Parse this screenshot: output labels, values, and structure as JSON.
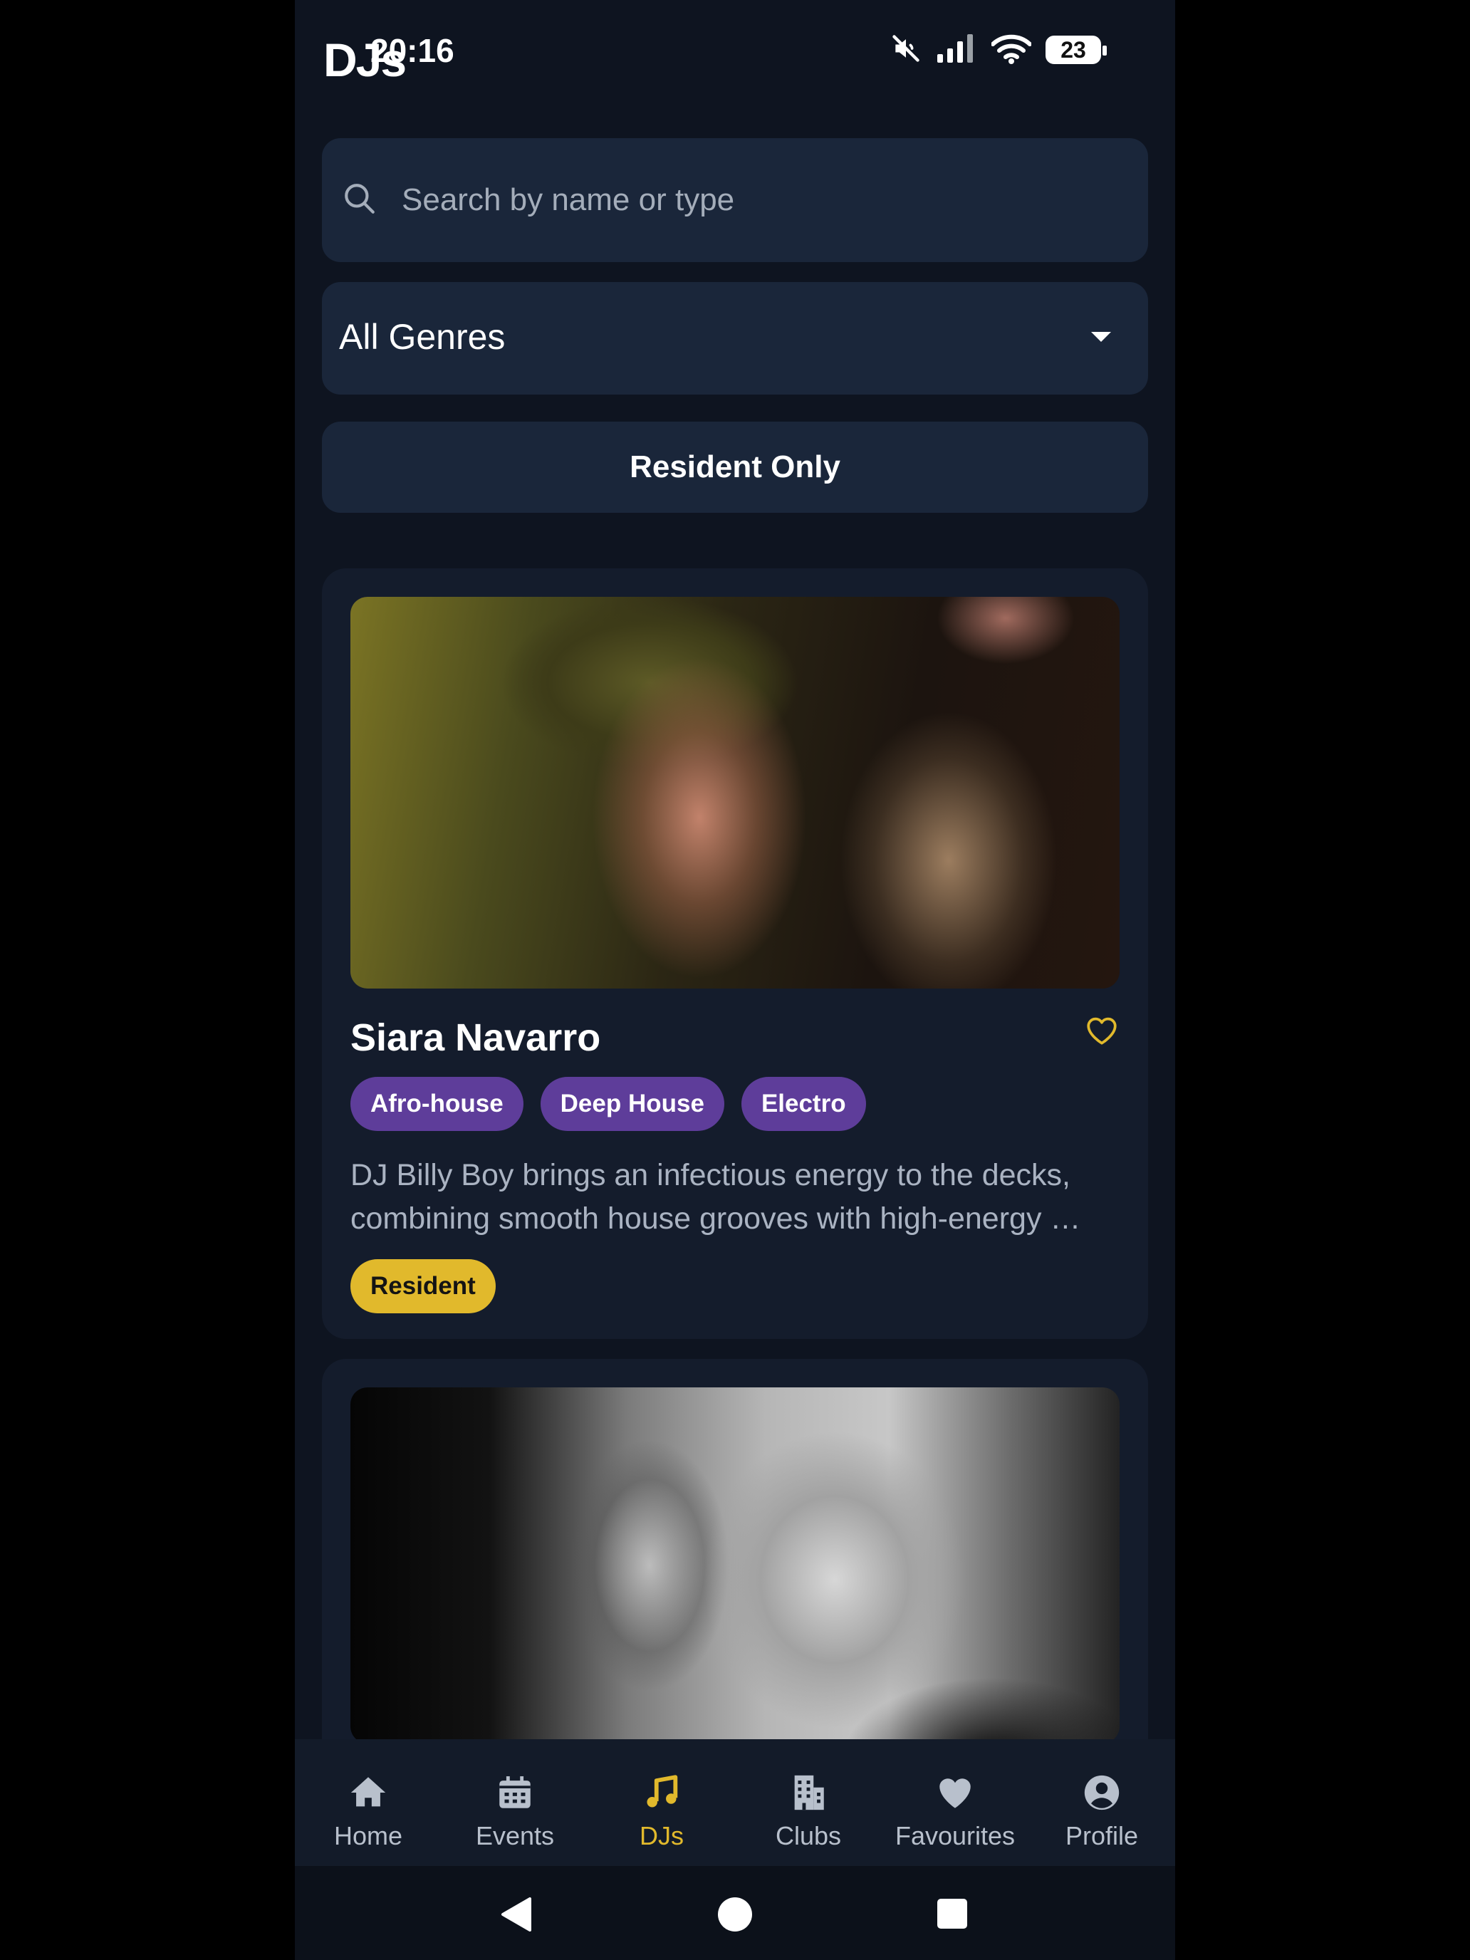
{
  "status_bar": {
    "app_title": "DJs",
    "time": "20:16",
    "battery": "23"
  },
  "search": {
    "placeholder": "Search by name or type",
    "value": ""
  },
  "genre_filter": {
    "selected": "All Genres"
  },
  "resident_toggle": {
    "label": "Resident Only"
  },
  "djs": [
    {
      "name": "Siara Navarro",
      "genres": [
        "Afro-house",
        "Deep House",
        "Electro"
      ],
      "bio": "DJ Billy Boy brings an infectious energy to the decks, combining smooth house grooves with high-energy …",
      "badge": "Resident",
      "favourite": false
    }
  ],
  "bottom_nav": {
    "items": [
      {
        "label": "Home",
        "icon": "home-icon",
        "active": false
      },
      {
        "label": "Events",
        "icon": "calendar-icon",
        "active": false
      },
      {
        "label": "DJs",
        "icon": "music-note-icon",
        "active": true
      },
      {
        "label": "Clubs",
        "icon": "building-icon",
        "active": false
      },
      {
        "label": "Favourites",
        "icon": "heart-icon",
        "active": false
      },
      {
        "label": "Profile",
        "icon": "profile-icon",
        "active": false
      }
    ]
  },
  "colors": {
    "background": "#0e1420",
    "surface": "#1a263a",
    "card": "#141c2c",
    "accent": "#e1b92c",
    "genre_tag": "#5e3d9a"
  }
}
